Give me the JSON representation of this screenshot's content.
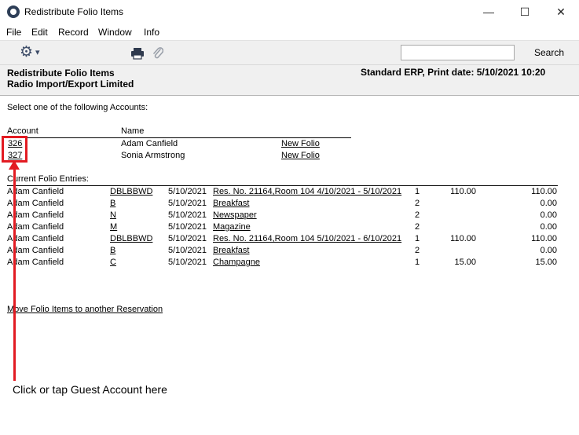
{
  "window": {
    "title": "Redistribute Folio Items",
    "minimize_glyph": "—",
    "maximize_glyph": "☐",
    "close_glyph": "✕"
  },
  "menu": [
    "File",
    "Edit",
    "Record",
    "Window",
    "Info"
  ],
  "toolbar": {
    "gear_glyph": "⚙",
    "dropdown_glyph": "▾",
    "search_value": "",
    "search_label": "Search"
  },
  "report": {
    "title": "Redistribute Folio Items",
    "company": "Radio Import/Export Limited",
    "print_info": "Standard ERP, Print date: 5/10/2021 10:20"
  },
  "accounts_section": {
    "prompt": "Select one of the following Accounts:",
    "headers": {
      "account": "Account",
      "name": "Name"
    },
    "rows": [
      {
        "account": "326",
        "name": "Adam Canfield",
        "action": "New Folio"
      },
      {
        "account": "327",
        "name": "Sonia Armstrong",
        "action": "New Folio"
      }
    ]
  },
  "folio_section": {
    "label": "Current Folio Entries:",
    "rows": [
      {
        "name": "Adam Canfield",
        "code": "DBLBBWD",
        "date": "5/10/2021",
        "desc": "Res. No. 21164,Room 104 4/10/2021 - 5/10/2021",
        "qty": "1",
        "price": "110.00",
        "total": "110.00"
      },
      {
        "name": "Adam Canfield",
        "code": "B",
        "date": "5/10/2021",
        "desc": "Breakfast",
        "qty": "2",
        "price": "",
        "total": "0.00"
      },
      {
        "name": "Adam Canfield",
        "code": "N",
        "date": "5/10/2021",
        "desc": "Newspaper",
        "qty": "2",
        "price": "",
        "total": "0.00"
      },
      {
        "name": "Adam Canfield",
        "code": "M",
        "date": "5/10/2021",
        "desc": "Magazine",
        "qty": "2",
        "price": "",
        "total": "0.00"
      },
      {
        "name": "Adam Canfield",
        "code": "DBLBBWD",
        "date": "5/10/2021",
        "desc": "Res. No. 21164,Room 104 5/10/2021 - 6/10/2021",
        "qty": "1",
        "price": "110.00",
        "total": "110.00"
      },
      {
        "name": "Adam Canfield",
        "code": "B",
        "date": "5/10/2021",
        "desc": "Breakfast",
        "qty": "2",
        "price": "",
        "total": "0.00"
      },
      {
        "name": "Adam Canfield",
        "code": "C",
        "date": "5/10/2021",
        "desc": "Champagne",
        "qty": "1",
        "price": "15.00",
        "total": "15.00"
      }
    ]
  },
  "move_link": "Move Folio Items to another Reservation",
  "annotation": {
    "text": "Click or tap Guest Account here",
    "color": "#e21b22"
  }
}
